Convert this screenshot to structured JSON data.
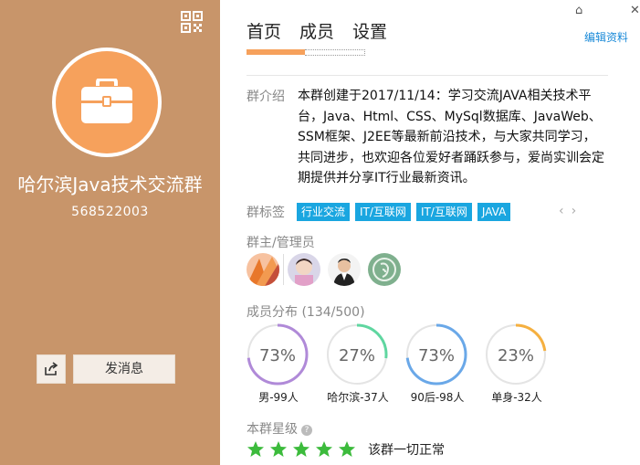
{
  "sidebar": {
    "group_name": "哈尔滨Java技术交流群",
    "group_id": "568522003",
    "send_message_label": "发消息",
    "qr_icon": "qr-code-icon",
    "share_icon": "share-icon",
    "avatar_icon": "briefcase-icon",
    "bg_color": "#c8956a",
    "avatar_color": "#f6a15c"
  },
  "window": {
    "home_icon": "⌂",
    "close_icon": "✕",
    "edit_label": "编辑资料"
  },
  "tabs": [
    {
      "label": "首页"
    },
    {
      "label": "成员"
    },
    {
      "label": "设置"
    }
  ],
  "intro": {
    "label": "群介绍",
    "text": "本群创建于2017/11/14：学习交流JAVA相关技术平台，Java、Html、CSS、MySql数据库、JavaWeb、SSM框架、J2EE等最新前沿技术，与大家共同学习，共同进步，也欢迎各位爱好者踊跃参与，爱尚实训会定期提供并分享IT行业最新资讯。"
  },
  "tags": {
    "label": "群标签",
    "items": [
      "行业交流",
      "IT/互联网",
      "IT/互联网",
      "JAVA"
    ],
    "color": "#1aa6e0",
    "prev_icon": "‹",
    "next_icon": "›"
  },
  "admins": {
    "label": "群主/管理员"
  },
  "distribution": {
    "label": "成员分布",
    "count": "(134/500)",
    "items": [
      {
        "pct": "73%",
        "value": 0.73,
        "caption": "男-99人",
        "color": "#b08ad8"
      },
      {
        "pct": "27%",
        "value": 0.27,
        "caption": "哈尔滨-37人",
        "color": "#5fd6a0"
      },
      {
        "pct": "73%",
        "value": 0.73,
        "caption": "90后-98人",
        "color": "#6aa8e8"
      },
      {
        "pct": "23%",
        "value": 0.23,
        "caption": "单身-32人",
        "color": "#f5b040"
      }
    ]
  },
  "rank": {
    "label": "本群星级",
    "stars": 5,
    "status": "该群一切正常",
    "star_color": "#3cbb3c"
  }
}
